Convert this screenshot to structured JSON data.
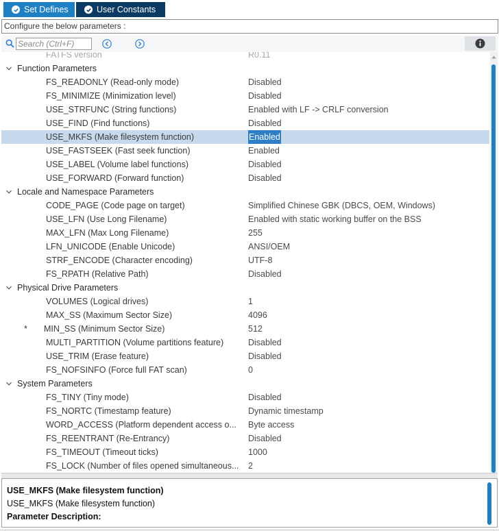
{
  "tabs": [
    {
      "label": "Set Defines"
    },
    {
      "label": "User Constants"
    }
  ],
  "header": {
    "text": "Configure the below parameters :"
  },
  "search": {
    "placeholder": "Search (Ctrl+F)"
  },
  "tree": {
    "partial_row": {
      "name": "FATFS version",
      "value": "R0.11"
    },
    "groups": [
      {
        "title": "Function Parameters",
        "items": [
          {
            "name": "FS_READONLY (Read-only mode)",
            "value": "Disabled"
          },
          {
            "name": "FS_MINIMIZE (Minimization level)",
            "value": "Disabled"
          },
          {
            "name": "USE_STRFUNC (String functions)",
            "value": "Enabled with LF -> CRLF conversion"
          },
          {
            "name": "USE_FIND (Find functions)",
            "value": "Disabled"
          },
          {
            "name": "USE_MKFS (Make filesystem function)",
            "value": "Enabled",
            "selected": true
          },
          {
            "name": "USE_FASTSEEK (Fast seek function)",
            "value": "Enabled"
          },
          {
            "name": "USE_LABEL (Volume label functions)",
            "value": "Disabled"
          },
          {
            "name": "USE_FORWARD (Forward function)",
            "value": "Disabled"
          }
        ]
      },
      {
        "title": "Locale and Namespace Parameters",
        "items": [
          {
            "name": "CODE_PAGE (Code page on target)",
            "value": "Simplified Chinese GBK (DBCS, OEM, Windows)"
          },
          {
            "name": "USE_LFN (Use Long Filename)",
            "value": "Enabled with static working buffer on the BSS"
          },
          {
            "name": "MAX_LFN (Max Long Filename)",
            "value": "255"
          },
          {
            "name": "LFN_UNICODE (Enable Unicode)",
            "value": "ANSI/OEM"
          },
          {
            "name": "STRF_ENCODE (Character encoding)",
            "value": "UTF-8"
          },
          {
            "name": "FS_RPATH (Relative Path)",
            "value": "Disabled"
          }
        ]
      },
      {
        "title": "Physical Drive Parameters",
        "items": [
          {
            "name": "VOLUMES (Logical drives)",
            "value": "1"
          },
          {
            "name": "MAX_SS (Maximum Sector Size)",
            "value": "4096"
          },
          {
            "name": "MIN_SS (Minimum Sector Size)",
            "value": "512",
            "modified": "*"
          },
          {
            "name": "MULTI_PARTITION (Volume partitions feature)",
            "value": "Disabled"
          },
          {
            "name": "USE_TRIM (Erase feature)",
            "value": "Disabled"
          },
          {
            "name": "FS_NOFSINFO (Force full FAT scan)",
            "value": "0"
          }
        ]
      },
      {
        "title": "System Parameters",
        "items": [
          {
            "name": "FS_TINY (Tiny mode)",
            "value": "Disabled"
          },
          {
            "name": "FS_NORTC (Timestamp feature)",
            "value": "Dynamic timestamp"
          },
          {
            "name": "WORD_ACCESS (Platform dependent access o...",
            "value": "Byte access"
          },
          {
            "name": "FS_REENTRANT (Re-Entrancy)",
            "value": "Disabled"
          },
          {
            "name": "FS_TIMEOUT (Timeout ticks)",
            "value": "1000"
          },
          {
            "name": "FS_LOCK (Number of files opened simultaneous...",
            "value": "2"
          }
        ]
      }
    ]
  },
  "description": {
    "title": "USE_MKFS (Make filesystem function)",
    "subtitle": "USE_MKFS (Make filesystem function)",
    "label": "Parameter Description:"
  },
  "colors": {
    "tab_active": "#1f7fc3",
    "tab_inactive": "#0b3a63",
    "selection_row": "#c7d9ec",
    "selection_value": "#2f7fc6",
    "icon_blue": "#2a7fd4"
  },
  "icons": {
    "tab": "check-circle-icon",
    "search": "search-icon",
    "prev": "chevron-left-circle-icon",
    "next": "chevron-right-circle-icon",
    "info": "info-icon",
    "group": "chevron-down-icon"
  }
}
